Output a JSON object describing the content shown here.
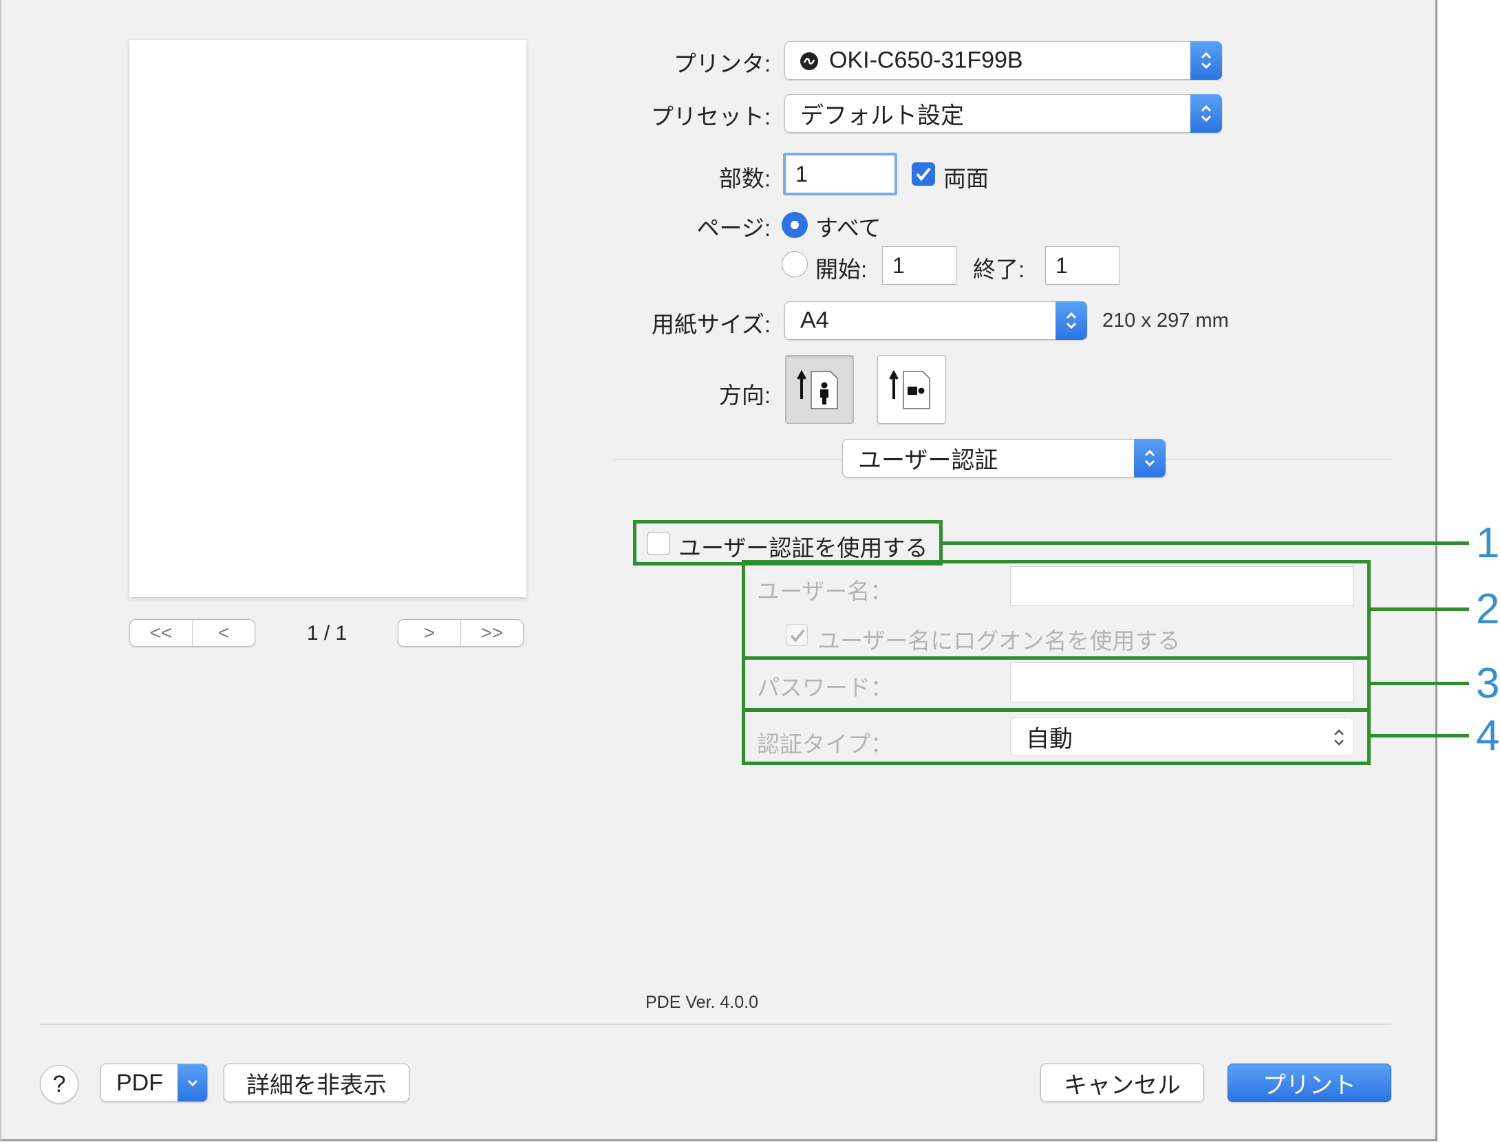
{
  "form": {
    "printer_label": "プリンタ:",
    "printer_value": "OKI-C650-31F99B",
    "preset_label": "プリセット:",
    "preset_value": "デフォルト設定",
    "copies_label": "部数:",
    "copies_value": "1",
    "duplex_label": "両面",
    "duplex_checked": true,
    "pages_label": "ページ:",
    "pages_all": "すべて",
    "pages_from_label": "開始:",
    "pages_from_value": "1",
    "pages_to_label": "終了:",
    "pages_to_value": "1",
    "paper_label": "用紙サイズ:",
    "paper_value": "A4",
    "paper_dims": "210 x 297 mm",
    "orientation_label": "方向:",
    "section_value": "ユーザー認証"
  },
  "preview": {
    "first_label": "<<",
    "prev_label": "<",
    "page_indicator": "1 / 1",
    "next_label": ">",
    "last_label": ">>"
  },
  "auth": {
    "use_auth_label": "ユーザー認証を使用する",
    "username_label": "ユーザー名：",
    "username_value": "",
    "use_login_label": "ユーザー名にログオン名を使用する",
    "password_label": "パスワード：",
    "password_value": "",
    "auth_type_label": "認証タイプ：",
    "auth_type_value": "自動"
  },
  "callouts": [
    "1",
    "2",
    "3",
    "4"
  ],
  "footer": {
    "version": "PDE Ver. 4.0.0",
    "help": "?",
    "pdf": "PDF",
    "hide_details": "詳細を非表示",
    "cancel": "キャンセル",
    "print": "プリント"
  },
  "colors": {
    "accent_blue": "#2c74e2",
    "callout_green": "#2f8f2f",
    "callout_number": "#3b8fce"
  }
}
